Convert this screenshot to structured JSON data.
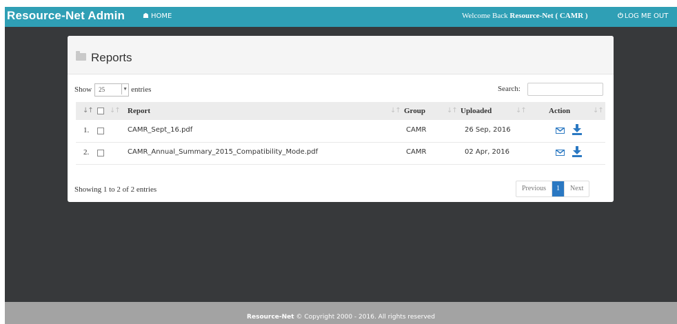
{
  "header": {
    "brand": "Resource-Net Admin",
    "home_label": "HOME",
    "welcome_prefix": "Welcome Back",
    "welcome_user": "Resource-Net ( CAMR )",
    "logout_label": "LOG ME OUT"
  },
  "panel": {
    "title": "Reports",
    "show_label": "Show",
    "entries_label": "entries",
    "page_length": "25",
    "search_label": "Search:",
    "search_value": ""
  },
  "table": {
    "columns": [
      "Report",
      "Group",
      "Uploaded",
      "Action"
    ],
    "rows": [
      {
        "num": "1.",
        "report": "CAMR_Sept_16.pdf",
        "group": "CAMR",
        "uploaded": "26 Sep, 2016"
      },
      {
        "num": "2.",
        "report": "CAMR_Annual_Summary_2015_Compatibility_Mode.pdf",
        "group": "CAMR",
        "uploaded": "02 Apr, 2016"
      }
    ]
  },
  "footer_info": "Showing 1 to 2 of 2 entries",
  "pagination": {
    "previous": "Previous",
    "page": "1",
    "next": "Next"
  },
  "footer": {
    "brand": "Resource-Net",
    "copyright": "© Copyright 2000 - 2016. All rights reserved"
  },
  "colors": {
    "topbar": "#2f9fb5",
    "accent": "#2a78c2",
    "background": "#37393b",
    "footer": "#a3a3a3"
  },
  "icons": [
    "home-icon",
    "power-icon",
    "folder-icon",
    "mail-icon",
    "download-icon",
    "sort-icon",
    "checkbox-icon"
  ]
}
